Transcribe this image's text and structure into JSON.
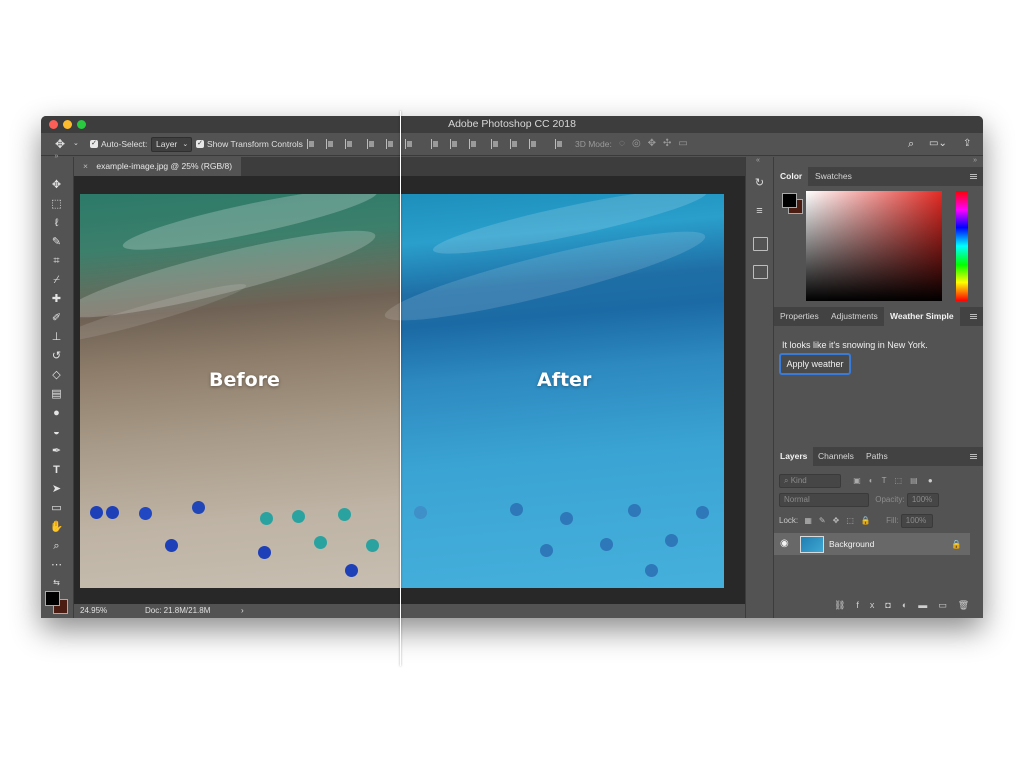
{
  "window": {
    "title": "Adobe Photoshop CC 2018"
  },
  "options_bar": {
    "auto_select_label": "Auto-Select:",
    "auto_select_value": "Layer",
    "show_transform_label": "Show Transform Controls",
    "mode_3d_label": "3D Mode:"
  },
  "document": {
    "tab_title": "example-image.jpg @ 25% (RGB/8)",
    "zoom": "24.95%",
    "doc_size": "Doc: 21.8M/21.8M",
    "before_label": "Before",
    "after_label": "After"
  },
  "color_panel": {
    "tabs": [
      "Color",
      "Swatches"
    ],
    "foreground": "#000000",
    "background": "#4b1c12"
  },
  "properties_panel": {
    "tabs": [
      "Properties",
      "Adjustments",
      "Weather Simple"
    ],
    "message": "It looks like it's snowing in New York.",
    "apply_button": "Apply weather"
  },
  "layers_panel": {
    "tabs": [
      "Layers",
      "Channels",
      "Paths"
    ],
    "kind_placeholder": "Kind",
    "blend_mode": "Normal",
    "opacity_label": "Opacity:",
    "opacity_value": "100%",
    "lock_label": "Lock:",
    "fill_label": "Fill:",
    "fill_value": "100%",
    "layer_name": "Background"
  },
  "colors": {
    "accent": "#3b7bd8",
    "panel": "#535353",
    "dark": "#282828"
  }
}
